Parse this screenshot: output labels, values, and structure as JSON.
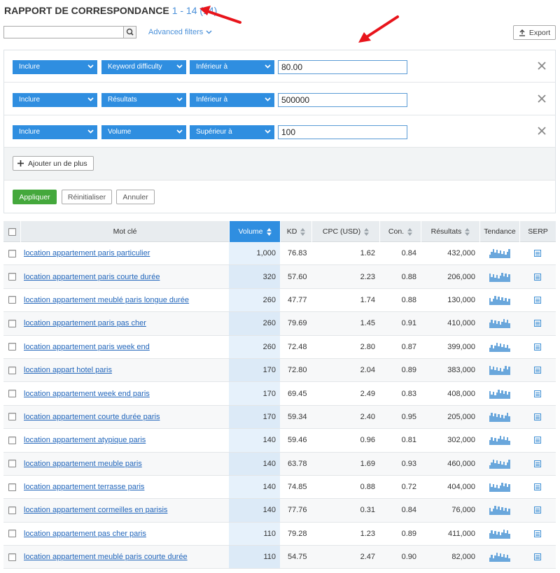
{
  "header": {
    "title": "RAPPORT DE CORRESPONDANCE",
    "range": "1 - 14 (14)",
    "advanced_filters": "Advanced filters",
    "export": "Export"
  },
  "search": {
    "value": "",
    "placeholder": ""
  },
  "filters": [
    {
      "include": "Inclure",
      "field": "Keyword difficulty",
      "op": "Inférieur à",
      "value": "80.00"
    },
    {
      "include": "Inclure",
      "field": "Résultats",
      "op": "Inférieur à",
      "value": "500000"
    },
    {
      "include": "Inclure",
      "field": "Volume",
      "op": "Supérieur à",
      "value": "100"
    }
  ],
  "actions": {
    "add": "Ajouter un de plus",
    "apply": "Appliquer",
    "reset": "Réinitialiser",
    "cancel": "Annuler"
  },
  "colors": {
    "accent": "#2f8ee0",
    "apply": "#44a83c",
    "arrow": "#e8141b",
    "link": "#2266bb"
  },
  "table": {
    "headers": {
      "keyword": "Mot clé",
      "volume": "Volume",
      "kd": "KD",
      "cpc": "CPC (USD)",
      "con": "Con.",
      "results": "Résultats",
      "trend": "Tendance",
      "serp": "SERP"
    },
    "rows": [
      {
        "keyword": "location appartement paris particulier",
        "volume": "1,000",
        "kd": "76.83",
        "cpc": "1.62",
        "con": "0.84",
        "results": "432,000"
      },
      {
        "keyword": "location appartement paris courte durée",
        "volume": "320",
        "kd": "57.60",
        "cpc": "2.23",
        "con": "0.88",
        "results": "206,000"
      },
      {
        "keyword": "location appartement meublé paris longue durée",
        "volume": "260",
        "kd": "47.77",
        "cpc": "1.74",
        "con": "0.88",
        "results": "130,000"
      },
      {
        "keyword": "location appartement paris pas cher",
        "volume": "260",
        "kd": "79.69",
        "cpc": "1.45",
        "con": "0.91",
        "results": "410,000"
      },
      {
        "keyword": "location appartement paris week end",
        "volume": "260",
        "kd": "72.48",
        "cpc": "2.80",
        "con": "0.87",
        "results": "399,000"
      },
      {
        "keyword": "location appart hotel paris",
        "volume": "170",
        "kd": "72.80",
        "cpc": "2.04",
        "con": "0.89",
        "results": "383,000"
      },
      {
        "keyword": "location appartement week end paris",
        "volume": "170",
        "kd": "69.45",
        "cpc": "2.49",
        "con": "0.83",
        "results": "408,000"
      },
      {
        "keyword": "location appartement courte durée paris",
        "volume": "170",
        "kd": "59.34",
        "cpc": "2.40",
        "con": "0.95",
        "results": "205,000"
      },
      {
        "keyword": "location appartement atypique paris",
        "volume": "140",
        "kd": "59.46",
        "cpc": "0.96",
        "con": "0.81",
        "results": "302,000"
      },
      {
        "keyword": "location appartement meuble paris",
        "volume": "140",
        "kd": "63.78",
        "cpc": "1.69",
        "con": "0.93",
        "results": "460,000"
      },
      {
        "keyword": "location appartement terrasse paris",
        "volume": "140",
        "kd": "74.85",
        "cpc": "0.88",
        "con": "0.72",
        "results": "404,000"
      },
      {
        "keyword": "location appartement cormeilles en parisis",
        "volume": "140",
        "kd": "77.76",
        "cpc": "0.31",
        "con": "0.84",
        "results": "76,000"
      },
      {
        "keyword": "location appartement pas cher paris",
        "volume": "110",
        "kd": "79.28",
        "cpc": "1.23",
        "con": "0.89",
        "results": "411,000"
      },
      {
        "keyword": "location appartement meublé paris courte durée",
        "volume": "110",
        "kd": "54.75",
        "cpc": "2.47",
        "con": "0.90",
        "results": "82,000"
      }
    ]
  }
}
